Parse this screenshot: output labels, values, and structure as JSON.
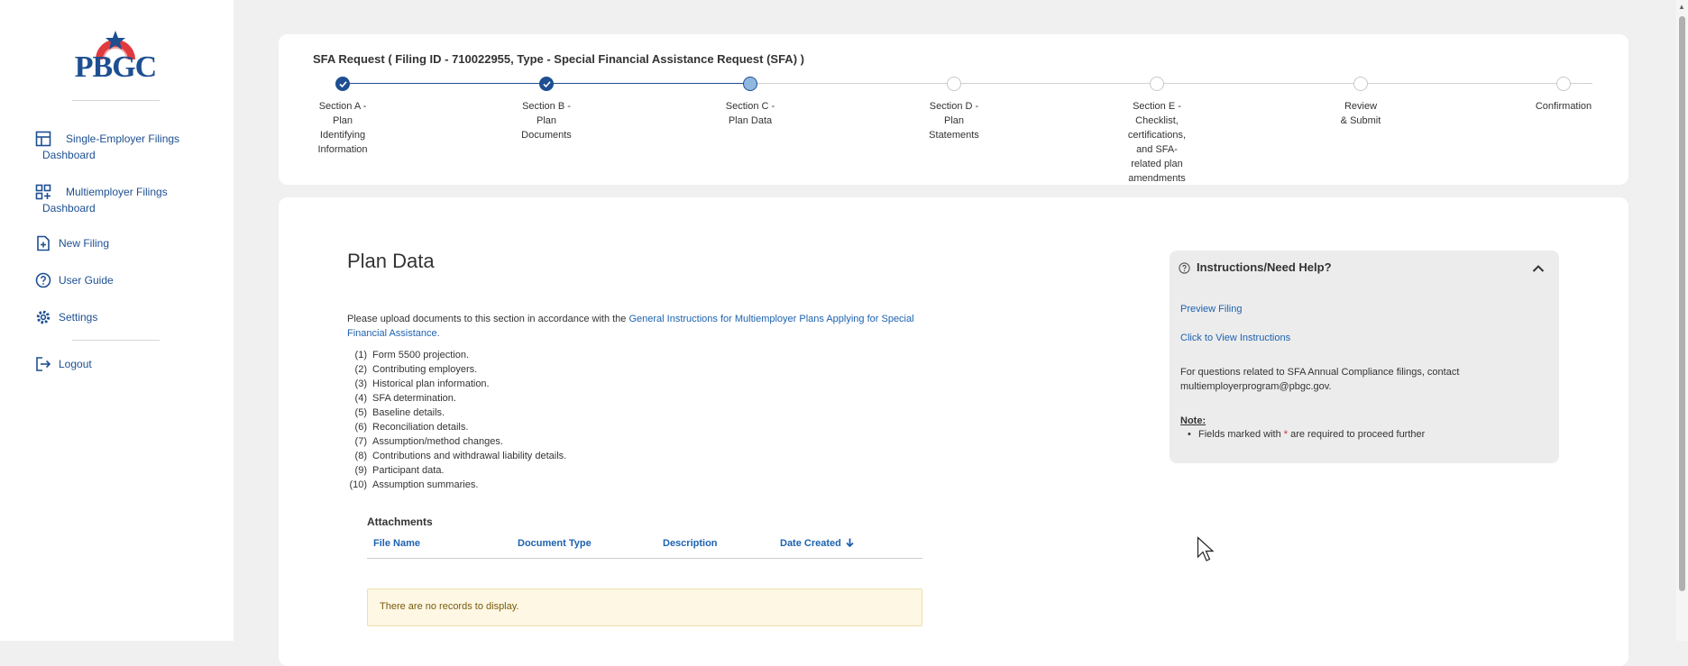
{
  "brand": {
    "logo_text": "PBGC"
  },
  "sidebar": {
    "items": [
      {
        "label": "Single-Employer Filings Dashboard",
        "icon": "dashboard-icon"
      },
      {
        "label": "Multiemployer Filings Dashboard",
        "icon": "grid-add-icon"
      },
      {
        "label": "New Filing",
        "icon": "file-add-icon"
      },
      {
        "label": "User Guide",
        "icon": "help-circle-icon"
      },
      {
        "label": "Settings",
        "icon": "gear-icon"
      },
      {
        "label": "Logout",
        "icon": "logout-icon"
      }
    ]
  },
  "progress": {
    "filing_title": "SFA Request ( Filing ID - 710022955, Type - Special Financial Assistance Request (SFA) )",
    "steps": [
      {
        "label": "Section A - Plan Identifying Information",
        "state": "done"
      },
      {
        "label": "Section B - Plan Documents",
        "state": "done"
      },
      {
        "label": "Section C - Plan Data",
        "state": "current"
      },
      {
        "label": "Section D - Plan Statements",
        "state": "future"
      },
      {
        "label": "Section E - Checklist, certifications, and SFA-related plan amendments",
        "state": "future"
      },
      {
        "label": "Review & Submit",
        "state": "future"
      },
      {
        "label": "Confirmation",
        "state": "future"
      }
    ]
  },
  "main": {
    "title": "Plan Data",
    "intro_text": "Please upload documents to this section in accordance with the ",
    "intro_link": "General Instructions for Multiemployer Plans Applying for Special Financial Assistance.",
    "items": [
      {
        "num": "(1)",
        "text": "Form 5500 projection."
      },
      {
        "num": "(2)",
        "text": "Contributing employers."
      },
      {
        "num": "(3)",
        "text": "Historical plan information."
      },
      {
        "num": "(4)",
        "text": "SFA determination."
      },
      {
        "num": "(5)",
        "text": "Baseline details."
      },
      {
        "num": "(6)",
        "text": "Reconciliation details."
      },
      {
        "num": "(7)",
        "text": "Assumption/method changes."
      },
      {
        "num": "(8)",
        "text": "Contributions and withdrawal liability details."
      },
      {
        "num": "(9)",
        "text": "Participant data."
      },
      {
        "num": "(10)",
        "text": "Assumption summaries."
      }
    ],
    "attachments": {
      "title": "Attachments",
      "columns": [
        "File Name",
        "Document Type",
        "Description",
        "Date Created"
      ],
      "sort_icon": "arrow-down-icon",
      "empty_text": "There are no records to display."
    }
  },
  "help": {
    "title": "Instructions/Need Help?",
    "preview_link": "Preview Filing",
    "instructions_link": "Click to View Instructions",
    "contact_text": "For questions related to SFA Annual Compliance filings, contact multiemployerprogram@pbgc.gov.",
    "note_label": "Note:",
    "note_pre": "Fields marked with ",
    "note_star": "*",
    "note_post": " are required to proceed further"
  },
  "colors": {
    "brand_blue": "#1d4f91",
    "link_blue": "#1d62b0",
    "current_step": "#8fb8e0",
    "empty_bg": "#fdf7e3"
  }
}
